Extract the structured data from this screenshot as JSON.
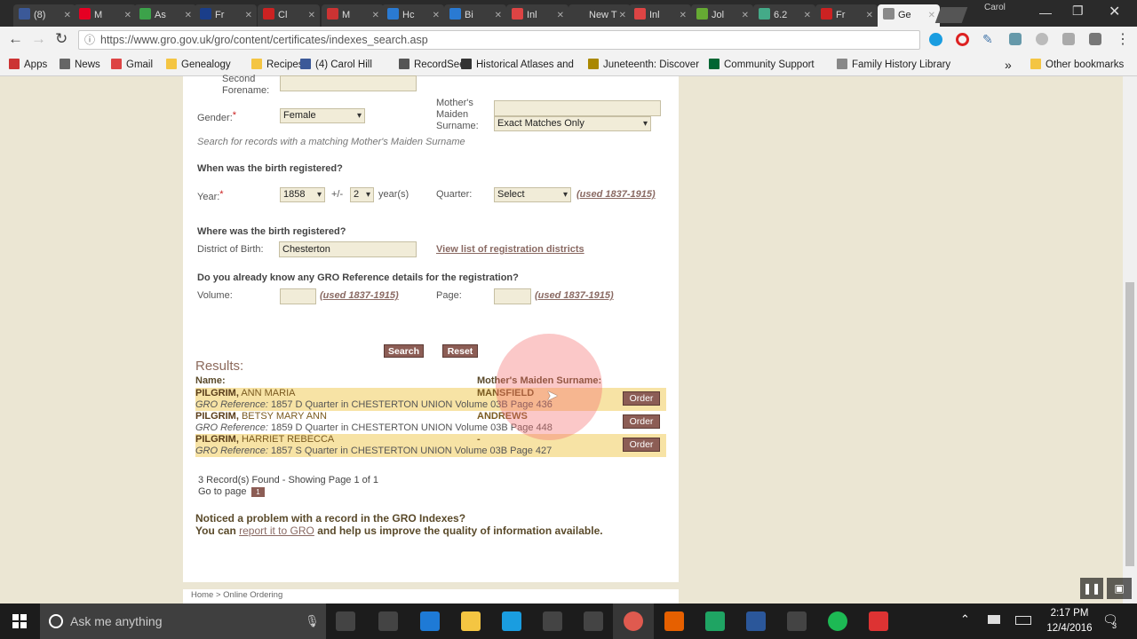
{
  "browser": {
    "tabs": [
      {
        "label": "(8)",
        "color": "#3b5998"
      },
      {
        "label": "M",
        "color": "#e60023"
      },
      {
        "label": "As",
        "color": "#3ca24a"
      },
      {
        "label": "Fr",
        "color": "#1a3e8a"
      },
      {
        "label": "Cl",
        "color": "#c22"
      },
      {
        "label": "M",
        "color": "#c33"
      },
      {
        "label": "Hc",
        "color": "#2a7ad2"
      },
      {
        "label": "Bi",
        "color": "#2a7ad2"
      },
      {
        "label": "Inl",
        "color": "#d44"
      },
      {
        "label": "New T",
        "color": ""
      },
      {
        "label": "Inl",
        "color": "#d44"
      },
      {
        "label": "Jol",
        "color": "#6a3"
      },
      {
        "label": "6.2",
        "color": "#4a8"
      },
      {
        "label": "Fr",
        "color": "#c22"
      },
      {
        "label": "Ge",
        "color": "#888"
      }
    ],
    "user": "Carol",
    "url": "https://www.gro.gov.uk/gro/content/certificates/indexes_search.asp",
    "bookmarks": [
      "Apps",
      "News",
      "Gmail",
      "Genealogy",
      "Recipes",
      "(4) Carol Hill",
      "RecordSeek",
      "Historical Atlases and",
      "Juneteenth: Discover",
      "Community Support",
      "Family History Library"
    ],
    "bookmarks_more": "»",
    "other_bookmarks": "Other bookmarks"
  },
  "form": {
    "second_forename_label": "Second Forename:",
    "gender_label": "Gender:",
    "gender_value": "Female",
    "required_mark": "*",
    "mmn_label": "Mother's Maiden Surname:",
    "mmn_match": "Exact Matches Only",
    "mmn_hint": "Search for records with a matching Mother's Maiden Surname",
    "when_heading": "When was the birth registered?",
    "year_label": "Year:",
    "year_value": "1858",
    "plusminus": "+/-",
    "range_value": "2",
    "years_label": "year(s)",
    "quarter_label": "Quarter:",
    "quarter_value": "Select",
    "used_note": "(used 1837-1915)",
    "where_heading": "Where was the birth registered?",
    "district_label": "District of Birth:",
    "district_value": "Chesterton",
    "district_link": "View list of registration districts",
    "gro_heading": "Do you already know any GRO Reference details for the registration?",
    "volume_label": "Volume:",
    "page_label": "Page:",
    "search_btn": "Search",
    "reset_btn": "Reset"
  },
  "results": {
    "heading": "Results:",
    "name_col": "Name:",
    "mmn_col": "Mother's Maiden Surname:",
    "ref_label": "GRO Reference:",
    "order_btn": "Order",
    "rows": [
      {
        "surname": "PILGRIM,",
        "forenames": "ANN  MARIA",
        "ref": "1857  D Quarter in CHESTERTON UNION  Volume 03B  Page 436",
        "mmn": "MANSFIELD"
      },
      {
        "surname": "PILGRIM,",
        "forenames": "BETSY  MARY ANN",
        "ref": "1859  D Quarter in CHESTERTON UNION  Volume 03B  Page 448",
        "mmn": "ANDREWS"
      },
      {
        "surname": "PILGRIM,",
        "forenames": "HARRIET  REBECCA",
        "ref": "1857  S Quarter in CHESTERTON UNION  Volume 03B  Page 427",
        "mmn": "-"
      }
    ],
    "records_found": "3 Record(s) Found - Showing Page 1 of 1",
    "goto_label": "Go to page",
    "current_page": "1",
    "notice_line1": "Noticed a problem with a record in the GRO Indexes?",
    "notice_you_can": "You can",
    "notice_link": "report it to GRO",
    "notice_rest": "and help us improve the quality of information available.",
    "breadcrumb": "Home > Online Ordering"
  },
  "taskbar": {
    "search_placeholder": "Ask me anything",
    "time": "2:17 PM",
    "date": "12/4/2016",
    "notifications": "3"
  },
  "colors": {
    "accent_button": "#8c5d55",
    "highlight_row": "#f7e3a5",
    "page_background": "#ebe6d3"
  }
}
